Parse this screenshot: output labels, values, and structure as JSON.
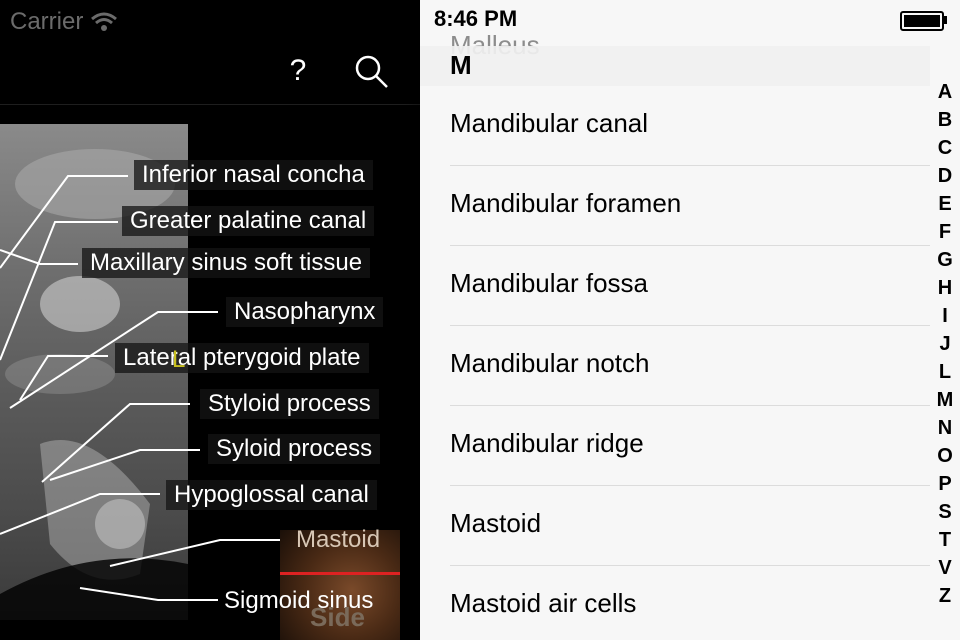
{
  "left_panel": {
    "carrier": "Carrier",
    "help_label": "?",
    "marker": "L",
    "side_label": "Side",
    "labels": [
      {
        "text": "Inferior nasal concha"
      },
      {
        "text": "Greater palatine canal"
      },
      {
        "text": "Maxillary sinus soft tissue"
      },
      {
        "text": "Nasopharynx"
      },
      {
        "text": "Lateral pterygoid plate"
      },
      {
        "text": "Styloid process"
      },
      {
        "text": "Syloid process"
      },
      {
        "text": "Hypoglossal canal"
      },
      {
        "text": "Mastoid"
      },
      {
        "text": "Sigmoid sinus"
      }
    ]
  },
  "right_panel": {
    "time": "8:46 PM",
    "previous_item": "Malleus",
    "section": "M",
    "items": [
      "Mandibular canal",
      "Mandibular foramen",
      "Mandibular fossa",
      "Mandibular notch",
      "Mandibular ridge",
      "Mastoid",
      "Mastoid air cells"
    ],
    "index": [
      "A",
      "B",
      "C",
      "D",
      "E",
      "F",
      "G",
      "H",
      "I",
      "J",
      "L",
      "M",
      "N",
      "O",
      "P",
      "S",
      "T",
      "V",
      "Z"
    ]
  }
}
